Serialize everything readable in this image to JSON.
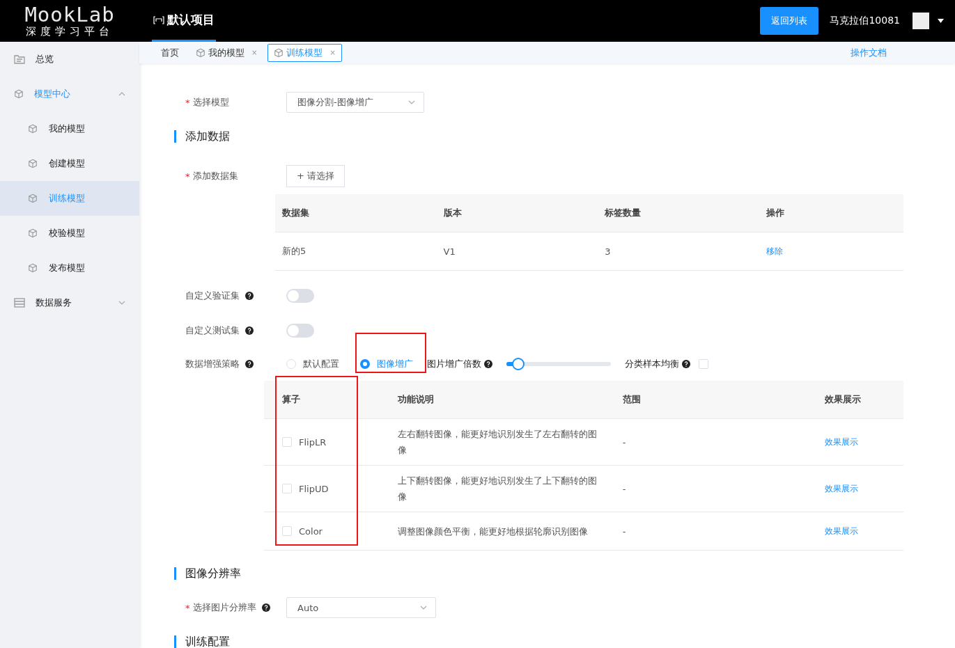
{
  "header": {
    "logo_title": "MookLab",
    "logo_subtitle": "深度学习平台",
    "project": "默认项目",
    "return_button": "返回列表",
    "user": "马克拉伯10081"
  },
  "sidebar": {
    "items": [
      {
        "label": "总览",
        "selected": false
      },
      {
        "label": "模型中心",
        "selected": false,
        "expanded": true,
        "children": [
          {
            "label": "我的模型",
            "selected": false
          },
          {
            "label": "创建模型",
            "selected": false
          },
          {
            "label": "训练模型",
            "selected": true
          },
          {
            "label": "校验模型",
            "selected": false
          },
          {
            "label": "发布模型",
            "selected": false
          }
        ]
      },
      {
        "label": "数据服务",
        "selected": false,
        "expanded": false
      }
    ]
  },
  "tabs": [
    {
      "label": "首页",
      "selected": false
    },
    {
      "label": "我的模型",
      "close": "×",
      "selected": false
    },
    {
      "label": "训练模型",
      "close": "×",
      "selected": true
    }
  ],
  "docs_link": "操作文档",
  "form": {
    "model_select": {
      "required_mark": "*",
      "label": "选择模型",
      "value": "图像分割-图像增广"
    },
    "section_data": "添加数据",
    "dataset": {
      "required_mark": "*",
      "label": "添加数据集",
      "button": "+ 请选择",
      "columns": [
        "数据集",
        "版本",
        "标签数量",
        "操作"
      ],
      "rows": [
        {
          "dataset": "新的5",
          "version": "V1",
          "label_count": "3",
          "action": "移除"
        }
      ]
    },
    "toggles": [
      {
        "label": "自定义验证集",
        "on": false
      },
      {
        "label": "自定义测试集",
        "on": false
      }
    ],
    "strategy": {
      "label": "数据增强策略",
      "options": [
        {
          "label": "默认配置",
          "selected": false
        },
        {
          "label": "图像增广",
          "selected": true
        }
      ],
      "multiplier_label": "图片增广倍数",
      "level": 0.11,
      "balance_label": "分类样本均衡",
      "balance_checked": false
    },
    "operators": {
      "columns": [
        "算子",
        "功能说明",
        "范围",
        "效果展示"
      ],
      "rows": [
        {
          "name": "FlipLR",
          "checked": false,
          "description": "左右翻转图像，能更好地识别发生了左右翻转的图像",
          "range": "-",
          "link": "效果展示"
        },
        {
          "name": "FlipUD",
          "checked": false,
          "description": "上下翻转图像，能更好地识别发生了上下翻转的图像",
          "range": "-",
          "link": "效果展示"
        },
        {
          "name": "Color",
          "checked": false,
          "description": "调整图像颜色平衡，能更好地根据轮廓识别图像",
          "range": "-",
          "link": "效果展示"
        }
      ]
    },
    "section_resolution": "图像分辨率",
    "resolution_select": {
      "required_mark": "*",
      "label": "选择图片分辨率",
      "value": "Auto"
    },
    "section_training": "训练配置"
  }
}
